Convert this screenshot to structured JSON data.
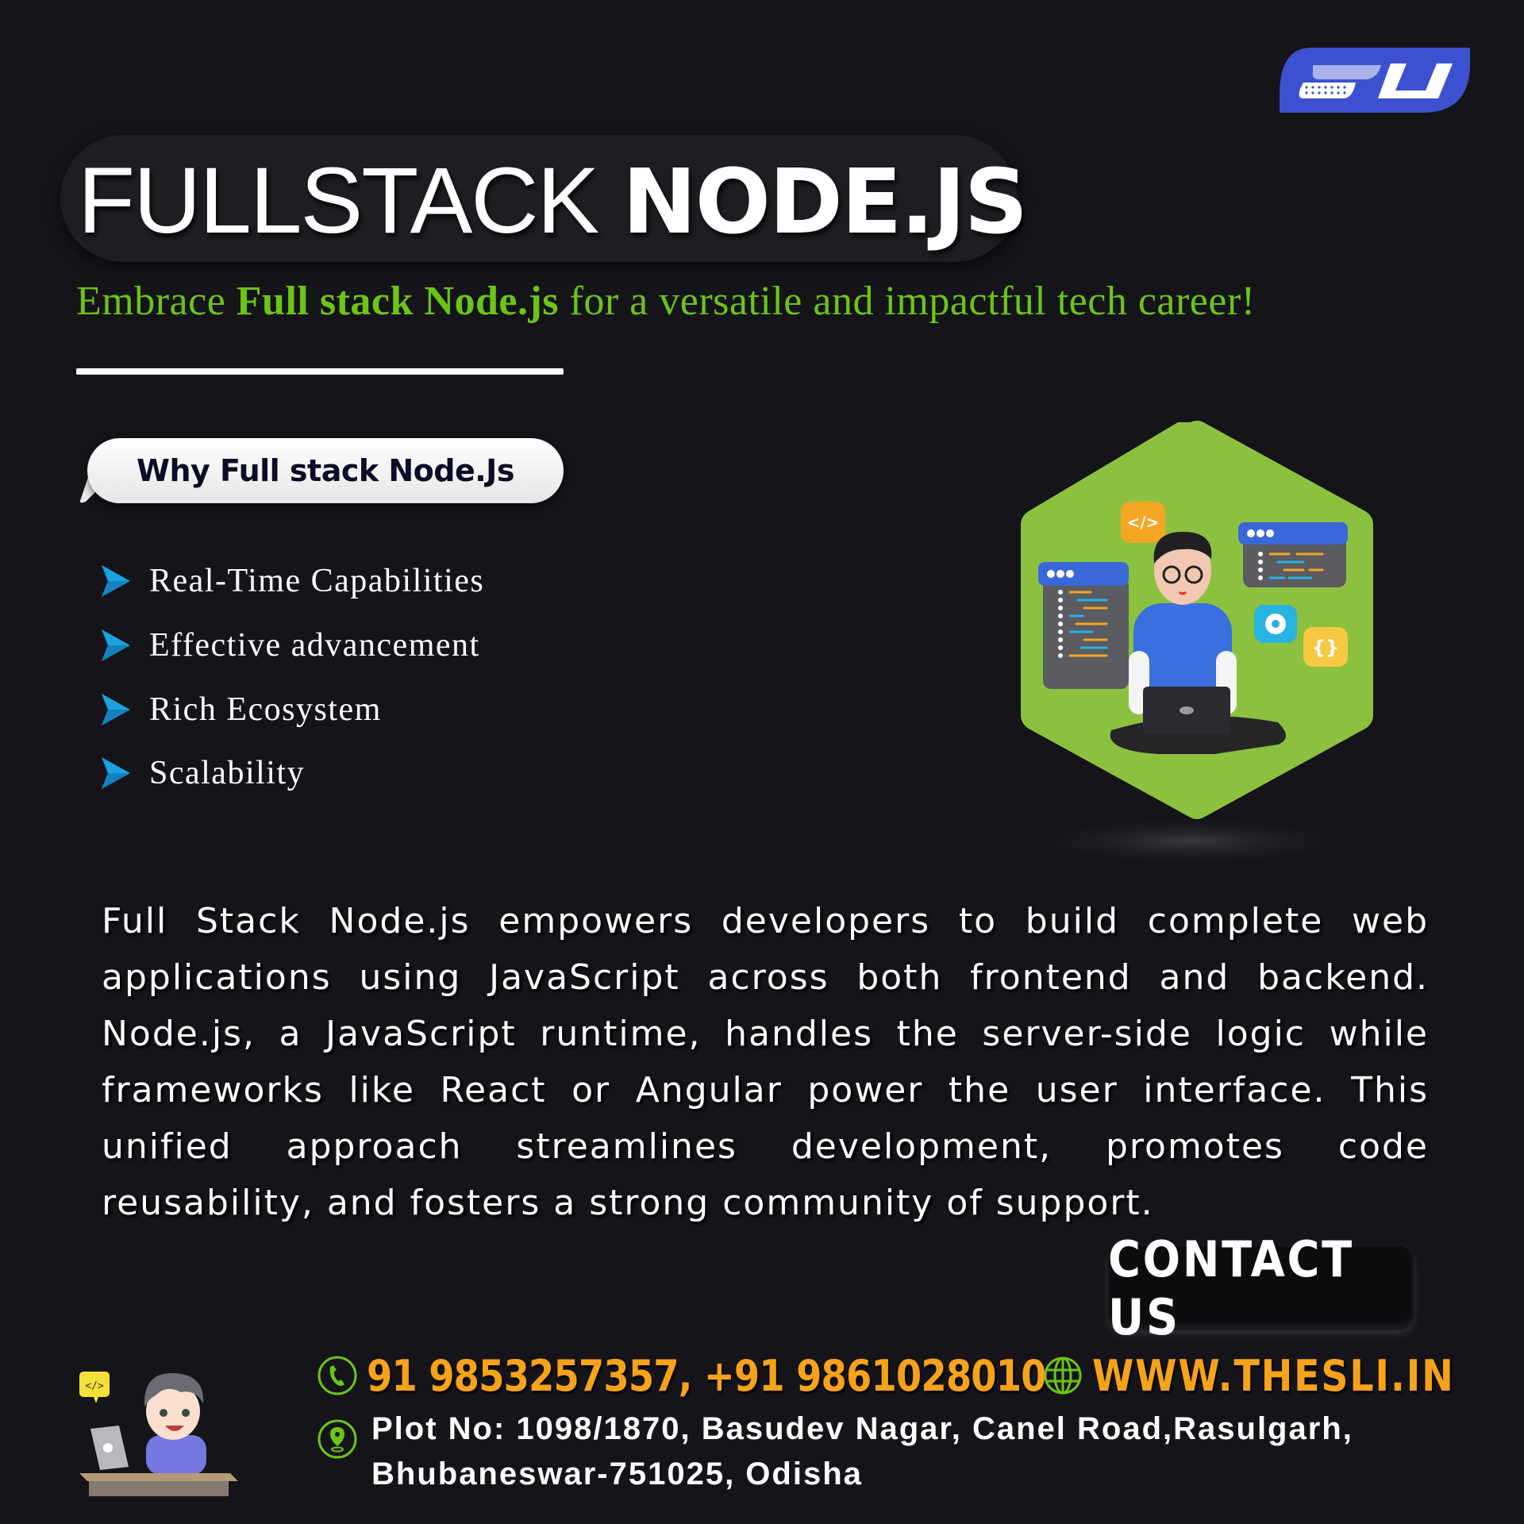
{
  "logo": {
    "text": "SLI",
    "color": "#3d51d0"
  },
  "header": {
    "title_light": "FULLSTACK ",
    "title_bold": "NODE.JS",
    "tagline_prefix": "Embrace ",
    "tagline_bold": "Full stack Node.js",
    "tagline_suffix": " for a versatile and impactful tech career!",
    "tagline_color": "#6cc417"
  },
  "why": {
    "heading": "Why Full stack Node.Js",
    "bullets": [
      {
        "label": "Real-Time Capabilities",
        "icon": "play-arrow-icon"
      },
      {
        "label": "Effective advancement",
        "icon": "play-arrow-icon"
      },
      {
        "label": "Rich Ecosystem",
        "icon": "play-arrow-icon"
      },
      {
        "label": "Scalability",
        "icon": "play-arrow-icon"
      }
    ],
    "bullet_color": "#1aa3e0"
  },
  "illustration": {
    "description": "Developer with laptop on green hexagon",
    "badges": [
      "</>",
      "gear",
      "{}"
    ],
    "hex_color": "#8cc13f"
  },
  "description": "Full Stack Node.js empowers developers to build complete web applications using JavaScript across both frontend and backend. Node.js, a JavaScript runtime, handles the server-side logic while frameworks like React or Angular power the user interface. This unified approach streamlines development, promotes code reusability, and fosters a strong community of support.",
  "contact": {
    "button_label": "CONTACT US",
    "phone": "91 9853257357, +91 9861028010",
    "website": "WWW.THESLI.IN",
    "address_line1": "Plot No: 1098/1870, Basudev Nagar, Canel Road,Rasulgarh,",
    "address_line2": "Bhubaneswar-751025, Odisha",
    "accent_color": "#f7a21b",
    "icon_color": "#6cc417"
  },
  "mascot": {
    "badge": "</>"
  }
}
